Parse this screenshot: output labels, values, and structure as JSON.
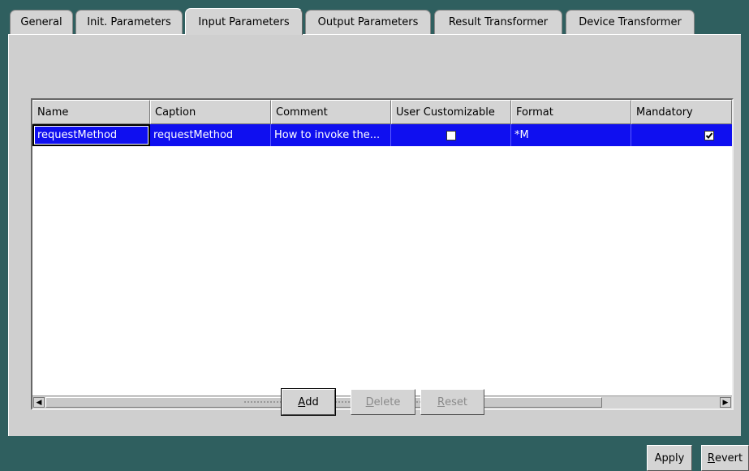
{
  "tabs": [
    {
      "label": "General"
    },
    {
      "label": "Init. Parameters"
    },
    {
      "label": "Input Parameters"
    },
    {
      "label": "Output Parameters"
    },
    {
      "label": "Result Transformer"
    },
    {
      "label": "Device Transformer"
    }
  ],
  "table": {
    "columns": [
      "Name",
      "Caption",
      "Comment",
      "User Customizable",
      "Format",
      "Mandatory"
    ],
    "rows": [
      {
        "name": "requestMethod",
        "caption": "requestMethod",
        "comment": "How to invoke the...",
        "user_customizable": false,
        "format": "*M",
        "mandatory": true
      }
    ]
  },
  "table_buttons": {
    "add": {
      "mnemonic": "A",
      "rest": "dd"
    },
    "delete": {
      "mnemonic": "D",
      "rest": "elete"
    },
    "reset": {
      "mnemonic": "R",
      "rest": "eset"
    }
  },
  "footer": {
    "apply_label": "Apply",
    "revert": {
      "mnemonic": "R",
      "rest": "evert"
    }
  },
  "colors": {
    "selection": "#0f0ff0",
    "panel": "#cfcfcf",
    "background": "#2f5f5f"
  }
}
